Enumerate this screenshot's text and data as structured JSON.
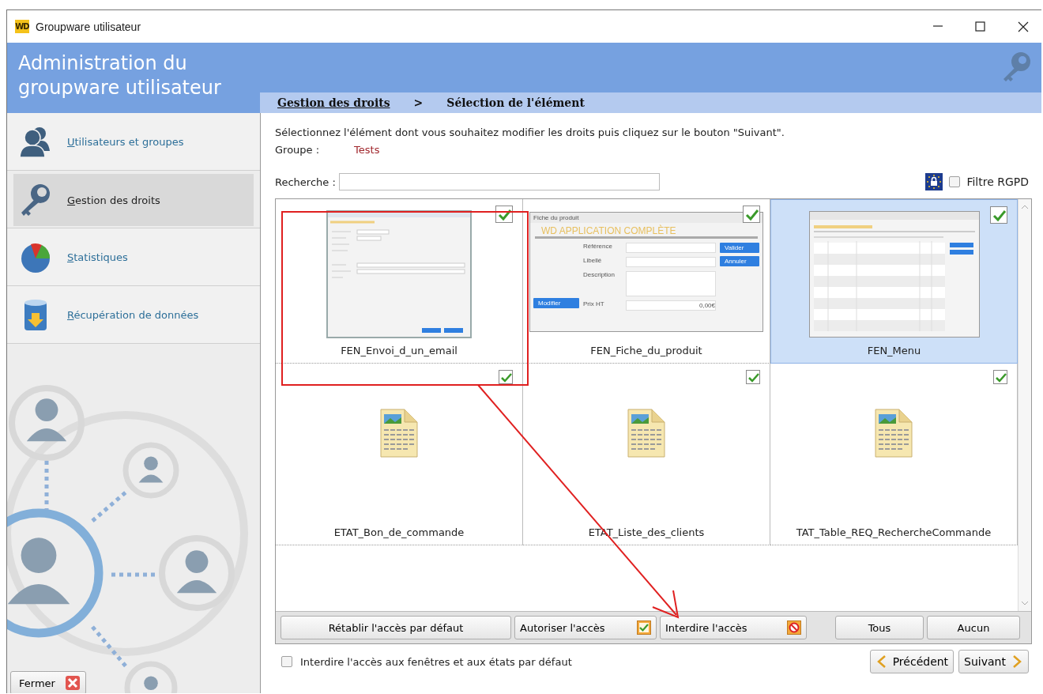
{
  "window": {
    "logo": "WD",
    "title": "Groupware utilisateur"
  },
  "header": {
    "title": "Administration du groupware utilisateur"
  },
  "breadcrumb": [
    {
      "label": "Gestion des droits",
      "kind": "link"
    },
    {
      "label": ">",
      "kind": "separator"
    },
    {
      "label": "Sélection de l'élément",
      "kind": "current"
    }
  ],
  "sidebar": {
    "items": [
      {
        "label": "Utilisateurs et groupes",
        "kind": "users",
        "selected": false
      },
      {
        "label": "Gestion des droits",
        "kind": "key",
        "selected": true
      },
      {
        "label": "Statistiques",
        "kind": "chart",
        "selected": false
      },
      {
        "label": "Récupération de données",
        "kind": "database",
        "selected": false
      }
    ],
    "close_button": "Fermer"
  },
  "content": {
    "instruction": "Sélectionnez l'élément dont vous souhaitez modifier les droits puis cliquez sur le bouton \"Suivant\".",
    "group_label": "Groupe :",
    "group_value": "Tests",
    "search": {
      "label": "Recherche :"
    },
    "filter": {
      "label": "Filtre RGPD",
      "checked": false
    }
  },
  "elements": [
    {
      "name": "FEN_Envoi_d_un_email",
      "checked": true,
      "selected": false,
      "kind": "blank-form"
    },
    {
      "name": "FEN_Fiche_du_produit",
      "checked": true,
      "selected": false,
      "kind": "product-form",
      "preview": {
        "title": "Fiche du produit",
        "heading": "WD APPLICATION COMPLÈTE",
        "fields": [
          "Référence",
          "Libellé",
          "Description",
          "Prix HT"
        ],
        "value": "0,00€",
        "side_buttons": [
          "Valider",
          "Annuler"
        ],
        "edit_button": "Modifier"
      }
    },
    {
      "name": "FEN_Menu",
      "checked": true,
      "selected": true,
      "kind": "menu-table"
    },
    {
      "name": "ETAT_Bon_de_commande",
      "checked": true,
      "selected": false,
      "kind": "report"
    },
    {
      "name": "ETAT_Liste_des_clients",
      "checked": true,
      "selected": false,
      "kind": "report"
    },
    {
      "name": "TAT_Table_REQ_RechercheCommande",
      "checked": true,
      "selected": false,
      "kind": "report"
    }
  ],
  "actions": [
    {
      "label": "Rétablir l'accès par défaut",
      "kind": "plain"
    },
    {
      "label": "Autoriser l'accès",
      "kind": "allow"
    },
    {
      "label": "Interdire l'accès",
      "kind": "deny"
    },
    {
      "label": "Tous",
      "kind": "plain"
    },
    {
      "label": "Aucun",
      "kind": "plain"
    }
  ],
  "default_deny": {
    "label": "Interdire l'accès aux fenêtres et aux états par défaut",
    "checked": false
  },
  "nav": [
    {
      "label": "Précédent",
      "kind": "prev"
    },
    {
      "label": "Suivant",
      "kind": "next"
    }
  ]
}
